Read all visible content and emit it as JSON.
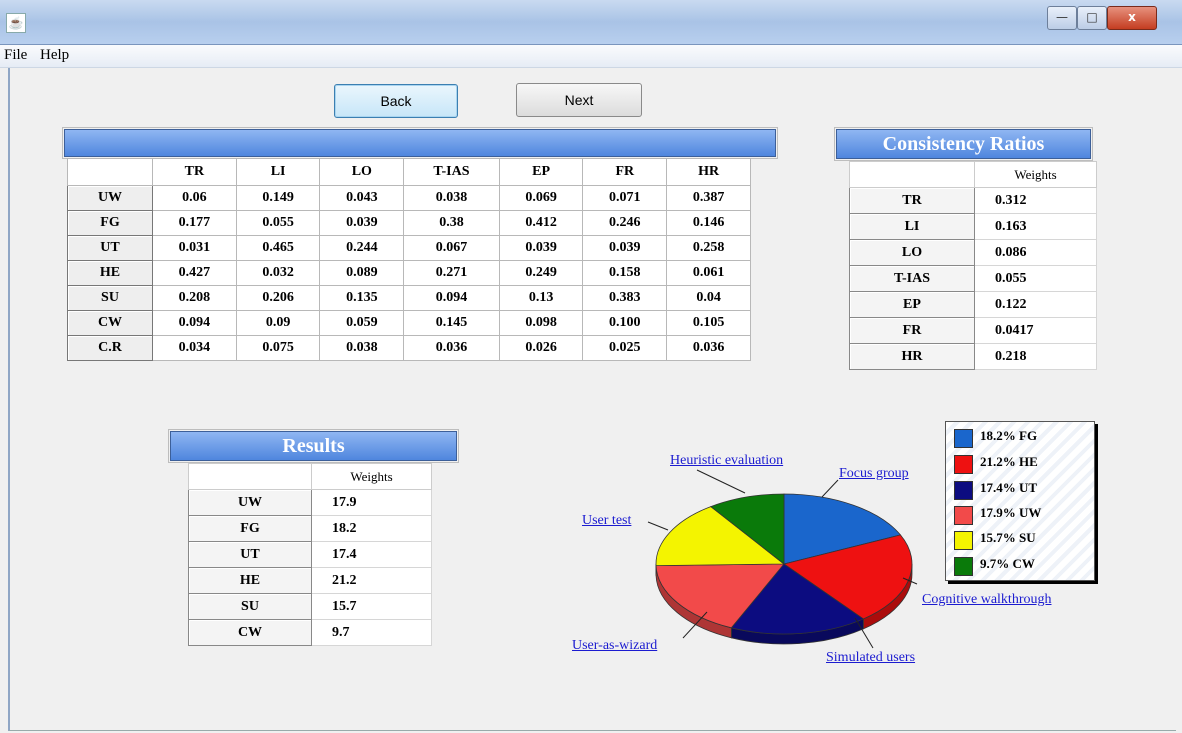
{
  "window": {
    "minimize": "—",
    "maximize": "□",
    "close": "x"
  },
  "menu": {
    "file": "File",
    "help": "Help"
  },
  "nav": {
    "back": "Back",
    "next": "Next"
  },
  "matrix": {
    "columns": [
      "TR",
      "LI",
      "LO",
      "T-IAS",
      "EP",
      "FR",
      "HR"
    ],
    "rows": [
      {
        "label": "UW",
        "values": [
          "0.06",
          "0.149",
          "0.043",
          "0.038",
          "0.069",
          "0.071",
          "0.387"
        ]
      },
      {
        "label": "FG",
        "values": [
          "0.177",
          "0.055",
          "0.039",
          "0.38",
          "0.412",
          "0.246",
          "0.146"
        ]
      },
      {
        "label": "UT",
        "values": [
          "0.031",
          "0.465",
          "0.244",
          "0.067",
          "0.039",
          "0.039",
          "0.258"
        ]
      },
      {
        "label": "HE",
        "values": [
          "0.427",
          "0.032",
          "0.089",
          "0.271",
          "0.249",
          "0.158",
          "0.061"
        ]
      },
      {
        "label": "SU",
        "values": [
          "0.208",
          "0.206",
          "0.135",
          "0.094",
          "0.13",
          "0.383",
          "0.04"
        ]
      },
      {
        "label": "CW",
        "values": [
          "0.094",
          "0.09",
          "0.059",
          "0.145",
          "0.098",
          "0.100",
          "0.105"
        ]
      },
      {
        "label": "C.R",
        "values": [
          "0.034",
          "0.075",
          "0.038",
          "0.036",
          "0.026",
          "0.025",
          "0.036"
        ]
      }
    ]
  },
  "consistency": {
    "title": "Consistency Ratios",
    "header": "Weights",
    "rows": [
      {
        "label": "TR",
        "value": "0.312"
      },
      {
        "label": "LI",
        "value": "0.163"
      },
      {
        "label": "LO",
        "value": "0.086"
      },
      {
        "label": "T-IAS",
        "value": "0.055"
      },
      {
        "label": "EP",
        "value": "0.122"
      },
      {
        "label": "FR",
        "value": "0.0417"
      },
      {
        "label": "HR",
        "value": "0.218"
      }
    ]
  },
  "results": {
    "title": "Results",
    "header": "Weights",
    "rows": [
      {
        "label": "UW",
        "value": "17.9"
      },
      {
        "label": "FG",
        "value": "18.2"
      },
      {
        "label": "UT",
        "value": "17.4"
      },
      {
        "label": "HE",
        "value": "21.2"
      },
      {
        "label": "SU",
        "value": "15.7"
      },
      {
        "label": "CW",
        "value": "9.7"
      }
    ]
  },
  "chart_data": {
    "type": "pie",
    "slices": [
      {
        "key": "FG",
        "name": "Focus group",
        "value": 18.2,
        "color": "#1a66cc",
        "legend": "18.2% FG"
      },
      {
        "key": "HE",
        "name": "Heuristic evaluation",
        "value": 21.2,
        "color": "#ee1111",
        "legend": "21.2% HE"
      },
      {
        "key": "UT",
        "name": "User test",
        "value": 17.4,
        "color": "#0c0c80",
        "legend": "17.4% UT"
      },
      {
        "key": "UW",
        "name": "User-as-wizard",
        "value": 17.9,
        "color": "#f24a4a",
        "legend": "17.9% UW"
      },
      {
        "key": "SU",
        "name": "Simulated users",
        "value": 15.7,
        "color": "#f4f400",
        "legend": "15.7% SU"
      },
      {
        "key": "CW",
        "name": "Cognitive walkthrough",
        "value": 9.7,
        "color": "#0a7a0a",
        "legend": "9.7% CW"
      }
    ]
  }
}
